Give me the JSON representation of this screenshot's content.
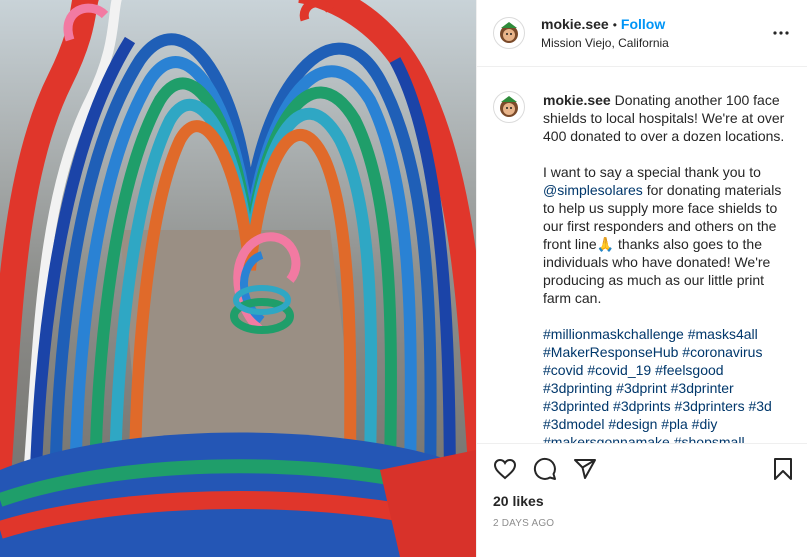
{
  "post": {
    "username": "mokie.see",
    "separator": "•",
    "follow_label": "Follow",
    "location": "Mission Viejo, California",
    "likes": "20 likes",
    "date": "2 DAYS AGO",
    "caption_lines": [
      "Donating another 100 face shields to local hospitals! We're at over 400 donated to over a dozen locations.",
      "",
      "I want to say a special thank you to "
    ],
    "mention": "@simplesolares",
    "caption_after_mention": " for donating materials to help us supply more face shields to our first responders and others on the front line🙏 thanks also goes to the individuals who have donated! We're producing as much as our little print farm can.",
    "hashtags": "#millionmaskchallenge #masks4all #MakerResponseHub #coronavirus #covid #covid_19 #feelsgood #3dprinting #3dprint #3dprinter #3dprinted #3dprints #3dprinters #3d #3dmodel #design #pla #diy #makersgonnamake #shopsmall"
  },
  "icons": {
    "more": "more-horizontal-icon",
    "like": "heart-icon",
    "comment": "comment-bubble-icon",
    "share": "paper-plane-icon",
    "save": "bookmark-icon"
  },
  "colors": {
    "follow": "#0095f6",
    "hashtag": "#00376b",
    "muted": "#8e8e8e"
  }
}
